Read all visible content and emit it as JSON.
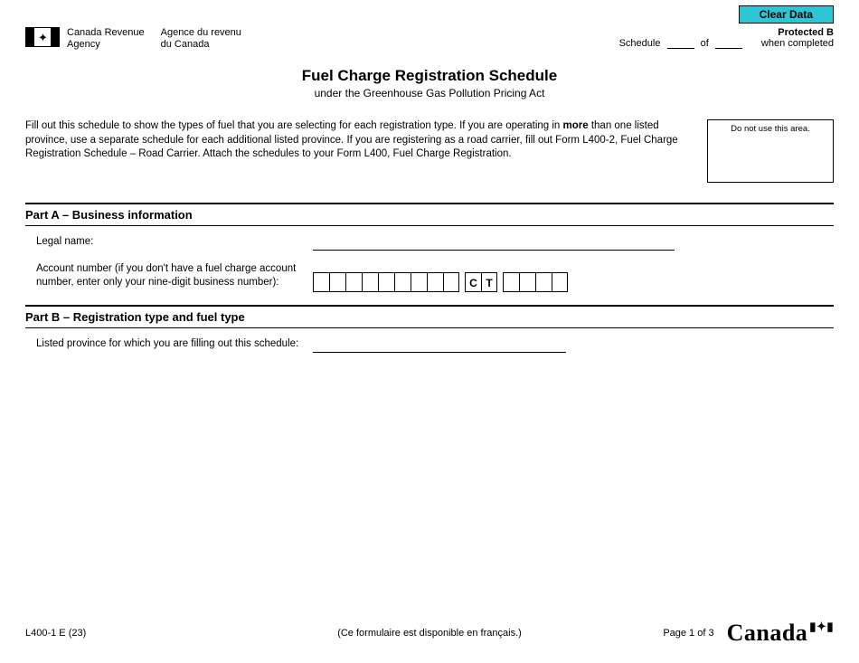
{
  "button": {
    "clear": "Clear Data"
  },
  "header": {
    "agency_en_line1": "Canada Revenue",
    "agency_en_line2": "Agency",
    "agency_fr_line1": "Agence du revenu",
    "agency_fr_line2": "du Canada",
    "schedule_word": "Schedule",
    "of_word": "of",
    "protected": "Protected B",
    "when_completed": "when completed"
  },
  "title": {
    "main": "Fuel Charge Registration Schedule",
    "sub": "under the Greenhouse Gas Pollution Pricing Act"
  },
  "intro": {
    "text_pre": "Fill out this schedule to show the types of fuel that you are selecting for each registration type. If you are operating in ",
    "more": "more",
    "text_post": " than one listed province, use a separate schedule for each additional listed province. If you are registering as a road carrier, fill out Form L400-2, Fuel Charge Registration Schedule – Road Carrier. Attach the schedules to your Form L400, Fuel Charge Registration.",
    "no_use": "Do not use this area."
  },
  "partA": {
    "heading": "Part A – Business information",
    "legal_name_label": "Legal name:",
    "acct_label": "Account number (if you don't have a fuel charge account number, enter only your nine-digit business number):",
    "acct_fixed_c": "C",
    "acct_fixed_t": "T"
  },
  "partB": {
    "heading": "Part B – Registration type and fuel type",
    "province_label": "Listed province for which you are filling out this schedule:"
  },
  "footer": {
    "form_code": "L400-1 E (23)",
    "french_note": "(Ce formulaire est disponible en français.)",
    "page": "Page 1 of 3",
    "wordmark": "Canada"
  }
}
